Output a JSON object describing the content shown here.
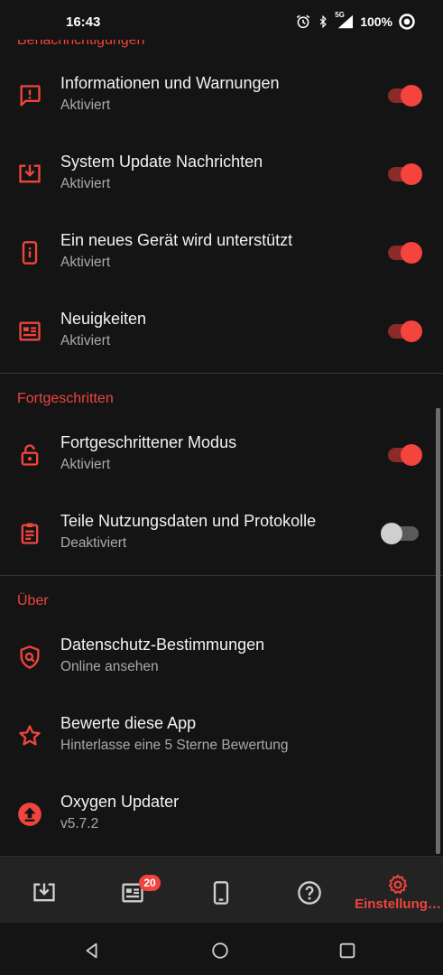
{
  "status_bar": {
    "time": "16:43",
    "network": "5G",
    "battery": "100%",
    "icons": [
      "alarm-icon",
      "bluetooth-icon",
      "signal-icon",
      "battery-icon"
    ]
  },
  "sections": {
    "notifications_header": "Benachrichtigungen",
    "advanced_header": "Fortgeschritten",
    "about_header": "Über"
  },
  "settings": {
    "info_warnings": {
      "title": "Informationen und Warnungen",
      "subtitle": "Aktiviert",
      "enabled": true
    },
    "system_update": {
      "title": "System Update Nachrichten",
      "subtitle": "Aktiviert",
      "enabled": true
    },
    "new_device": {
      "title": "Ein neues Gerät wird unterstützt",
      "subtitle": "Aktiviert",
      "enabled": true
    },
    "news": {
      "title": "Neuigkeiten",
      "subtitle": "Aktiviert",
      "enabled": true
    },
    "advanced_mode": {
      "title": "Fortgeschrittener Modus",
      "subtitle": "Aktiviert",
      "enabled": true
    },
    "share_data": {
      "title": "Teile Nutzungsdaten und Protokolle",
      "subtitle": "Deaktiviert",
      "enabled": false
    },
    "privacy": {
      "title": "Datenschutz-Bestimmungen",
      "subtitle": "Online ansehen"
    },
    "rate_app": {
      "title": "Bewerte diese App",
      "subtitle": "Hinterlasse eine 5 Sterne Bewertung"
    },
    "app_info": {
      "title": "Oxygen Updater",
      "subtitle": "v5.7.2"
    }
  },
  "bottom_nav": {
    "items": [
      {
        "icon": "download-icon",
        "label": ""
      },
      {
        "icon": "news-icon",
        "label": "",
        "badge": "20"
      },
      {
        "icon": "phone-icon",
        "label": ""
      },
      {
        "icon": "help-icon",
        "label": ""
      },
      {
        "icon": "settings-gear-icon",
        "label": "Einstellung…"
      }
    ]
  },
  "colors": {
    "accent": "#f0443d",
    "background": "#141414",
    "nav_background": "#232323",
    "text_secondary": "#a9a9a9"
  }
}
